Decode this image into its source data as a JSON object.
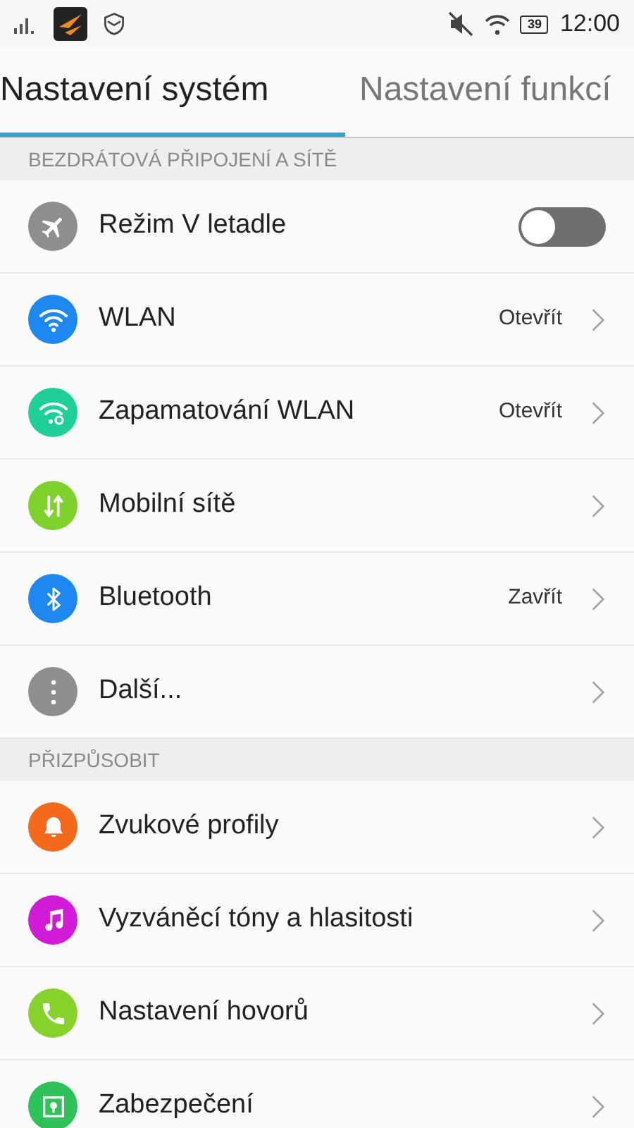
{
  "status_bar": {
    "time": "12:00",
    "battery": "39"
  },
  "tabs": [
    {
      "label": "Nastavení systém",
      "selected": true
    },
    {
      "label": "Nastavení funkcí",
      "selected": false
    }
  ],
  "sections": [
    {
      "title": "BEZDRÁTOVÁ PŘIPOJENÍ A SÍTĚ",
      "items": [
        {
          "kind": "toggle",
          "label": "Režim V letadle",
          "color": "#8e8e8e",
          "on": false
        },
        {
          "kind": "link",
          "label": "WLAN",
          "color": "#1e88f0",
          "value": "Otevřít"
        },
        {
          "kind": "link",
          "label": "Zapamatování WLAN",
          "color": "#1fcf98",
          "value": "Otevřít"
        },
        {
          "kind": "link",
          "label": "Mobilní sítě",
          "color": "#7fd12b"
        },
        {
          "kind": "link",
          "label": "Bluetooth",
          "color": "#1e88f0",
          "value": "Zavřít"
        },
        {
          "kind": "link",
          "label": "Další...",
          "color": "#8e8e8e"
        }
      ]
    },
    {
      "title": "PŘIZPŮSOBIT",
      "items": [
        {
          "kind": "link",
          "label": "Zvukové profily",
          "color": "#f46a1c"
        },
        {
          "kind": "link",
          "label": "Vyzváněcí tóny a hlasitosti",
          "color": "#d21bd6"
        },
        {
          "kind": "link",
          "label": "Nastavení hovorů",
          "color": "#86d12b"
        },
        {
          "kind": "link",
          "label": "Zabezpečení",
          "color": "#2fc25a"
        }
      ]
    }
  ]
}
